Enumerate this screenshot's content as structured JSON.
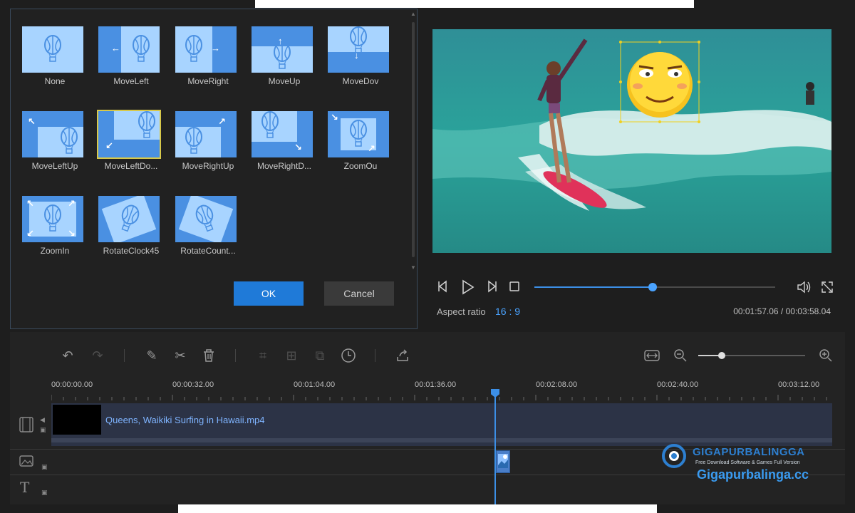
{
  "effects": {
    "items": [
      {
        "label": "None",
        "name": "none"
      },
      {
        "label": "MoveLeft",
        "name": "move-left"
      },
      {
        "label": "MoveRight",
        "name": "move-right"
      },
      {
        "label": "MoveUp",
        "name": "move-up"
      },
      {
        "label": "MoveDov",
        "name": "move-down"
      },
      {
        "label": "MoveLeftUp",
        "name": "move-left-up"
      },
      {
        "label": "MoveLeftDo...",
        "name": "move-left-down",
        "selected": true
      },
      {
        "label": "MoveRightUp",
        "name": "move-right-up"
      },
      {
        "label": "MoveRightD...",
        "name": "move-right-down"
      },
      {
        "label": "ZoomOu",
        "name": "zoom-out"
      },
      {
        "label": "ZoomIn",
        "name": "zoom-in"
      },
      {
        "label": "RotateClock45",
        "name": "rotate-clock-45"
      },
      {
        "label": "RotateCount...",
        "name": "rotate-counter"
      }
    ],
    "ok_label": "OK",
    "cancel_label": "Cancel"
  },
  "preview": {
    "aspect_label": "Aspect ratio",
    "aspect_value": "16 : 9",
    "time_readout": "00:01:57.06 / 00:03:58.04",
    "progress_fraction": 0.49
  },
  "timeline": {
    "ruler": [
      "00:00:00.00",
      "00:00:32.00",
      "00:01:04.00",
      "00:01:36.00",
      "00:02:08.00",
      "00:02:40.00",
      "00:03:12.00"
    ],
    "video_clip_title": "Queens, Waikiki  Surfing in Hawaii.mp4",
    "zoom_fraction": 0.22
  },
  "watermark": {
    "title": "GIGAPURBALINGGA",
    "subtitle": "Free Download Software & Games Full Version",
    "url": "Gigapurbalinga.cc"
  },
  "colors": {
    "accent": "#1f7ad8",
    "panel_bg": "#1e1e1e",
    "thumb_blue": "#4a90e2",
    "thumb_light": "#a8d4ff"
  }
}
